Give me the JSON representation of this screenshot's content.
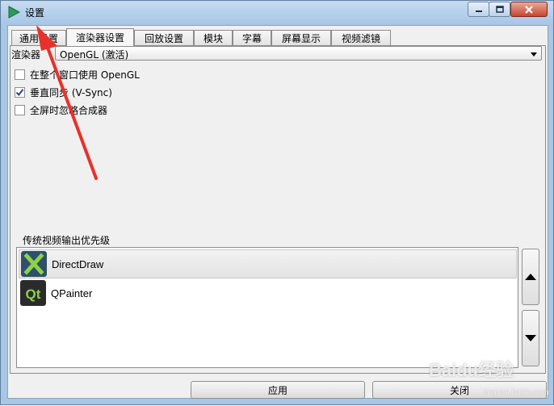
{
  "window": {
    "title": "设置",
    "icon": "play-triangle-icon",
    "accent": "#2c9c5a"
  },
  "tabs": [
    {
      "label": "通用设置"
    },
    {
      "label": "渲染器设置",
      "active": true
    },
    {
      "label": "回放设置"
    },
    {
      "label": "模块"
    },
    {
      "label": "字幕"
    },
    {
      "label": "屏幕显示"
    },
    {
      "label": "视频滤镜"
    }
  ],
  "renderer": {
    "label": "渲染器",
    "selected": "OpenGL (激活)"
  },
  "options": [
    {
      "label": "在整个窗口使用 OpenGL",
      "checked": false
    },
    {
      "label": "垂直同步 (V-Sync)",
      "checked": true
    },
    {
      "label": "全屏时忽略合成器",
      "checked": false
    }
  ],
  "legacy_output": {
    "group_title": "传统视频输出优先级",
    "items": [
      {
        "label": "DirectDraw",
        "icon": "directdraw-x-icon",
        "selected": true
      },
      {
        "label": "QPainter",
        "icon": "qt-logo-icon",
        "selected": false
      }
    ]
  },
  "buttons": {
    "apply": "应用",
    "close": "关闭"
  },
  "watermark": {
    "text": "Baidu经验",
    "sub": "jingyan.baidu.com"
  }
}
